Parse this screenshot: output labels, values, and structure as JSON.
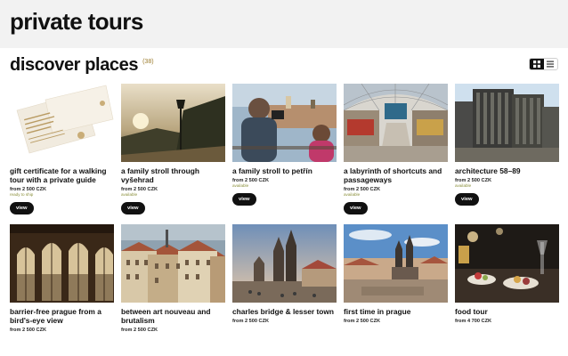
{
  "header": {
    "title": "private tours"
  },
  "section": {
    "title": "discover places",
    "count": "(38)"
  },
  "view_toggle": {
    "active": "grid"
  },
  "cards": [
    {
      "title": "gift certificate for a walking tour with a private guide",
      "price": "from 2 500 CZK",
      "status": "ready to ship",
      "button": "view",
      "image": "gift-certificate"
    },
    {
      "title": "a family stroll through vyšehrad",
      "price": "from 2 500 CZK",
      "status": "available",
      "button": "view",
      "image": "vysehrad-lamp"
    },
    {
      "title": "a family stroll to petřín",
      "price": "from 2 500 CZK",
      "status": "available",
      "button": "view",
      "image": "kids-view"
    },
    {
      "title": "a labyrinth of shortcuts and passageways",
      "price": "from 2 500 CZK",
      "status": "available",
      "button": "view",
      "image": "passage-hall"
    },
    {
      "title": "architecture 58–89",
      "price": "from 2 500 CZK",
      "status": "available",
      "button": "view",
      "image": "brutalist-building"
    },
    {
      "title": "barrier-free prague from a bird's-eye view",
      "price": "from 2 500 CZK",
      "status": "",
      "button": "",
      "image": "arched-windows"
    },
    {
      "title": "between art nouveau and brutalism",
      "price": "from 2 500 CZK",
      "status": "",
      "button": "",
      "image": "rooftops"
    },
    {
      "title": "charles bridge & lesser town",
      "price": "from 2 500 CZK",
      "status": "",
      "button": "",
      "image": "bridge-tower"
    },
    {
      "title": "first time in prague",
      "price": "from 2 500 CZK",
      "status": "",
      "button": "",
      "image": "old-town-square"
    },
    {
      "title": "food tour",
      "price": "from 4 700 CZK",
      "status": "",
      "button": "",
      "image": "food-table"
    }
  ]
}
